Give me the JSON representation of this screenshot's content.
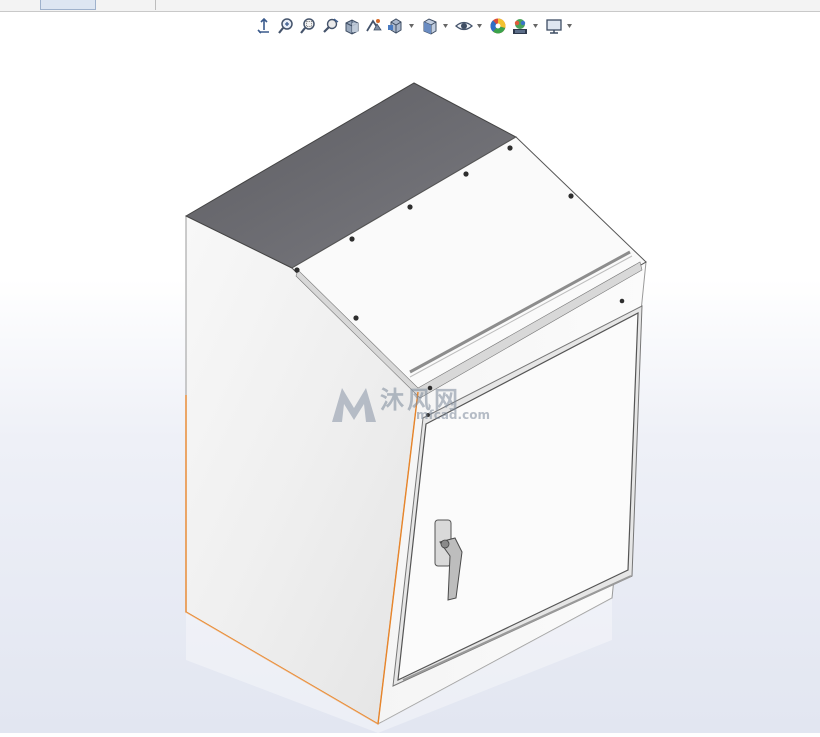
{
  "toolbar": {
    "items": [
      {
        "icon": "view-orientation-icon"
      },
      {
        "icon": "zoom-to-fit-icon"
      },
      {
        "icon": "zoom-to-area-icon"
      },
      {
        "icon": "previous-view-icon"
      },
      {
        "icon": "section-view-icon"
      },
      {
        "icon": "dynamic-annotation-icon"
      },
      {
        "icon": "view-orientation-cube-icon",
        "has_dropdown": true
      },
      {
        "icon": "display-style-icon",
        "has_dropdown": true
      },
      {
        "icon": "hide-show-items-icon",
        "has_dropdown": true
      },
      {
        "icon": "edit-appearance-icon"
      },
      {
        "icon": "apply-scene-icon",
        "has_dropdown": true
      },
      {
        "icon": "view-settings-icon",
        "has_dropdown": true
      }
    ]
  },
  "watermark": {
    "text": "沐风网",
    "url": "mfcad.com"
  },
  "colors": {
    "background_top": "#ffffff",
    "background_bottom": "#e2e6f1",
    "enclosure_body": "#f4f4f4",
    "enclosure_top_panel": "#6f6f73",
    "selection_edge": "#e8852a"
  }
}
